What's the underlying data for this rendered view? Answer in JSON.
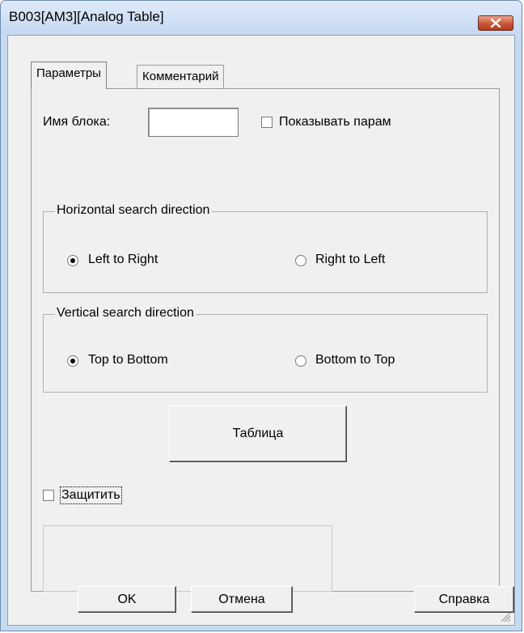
{
  "window": {
    "title": "B003[AM3][Analog Table]"
  },
  "tabs": {
    "parameters": "Параметры",
    "comment": "Комментарий"
  },
  "block": {
    "name_label": "Имя блока:",
    "name_value": "",
    "show_params_label": "Показывать парам",
    "show_params_checked": false
  },
  "horizontal": {
    "title": "Horizontal search direction",
    "left_to_right": "Left to Right",
    "right_to_left": "Right to Left",
    "selected": "Left to Right"
  },
  "vertical": {
    "title": "Vertical search direction",
    "top_to_bottom": "Top to Bottom",
    "bottom_to_top": "Bottom to Top",
    "selected": "Top to Bottom"
  },
  "table_button": "Таблица",
  "protect": {
    "label": "Защитить",
    "checked": false
  },
  "buttons": {
    "ok": "OK",
    "cancel": "Отмена",
    "help": "Справка"
  },
  "icons": {
    "close": "close-icon",
    "resize_grip": "resize-grip-icon"
  }
}
